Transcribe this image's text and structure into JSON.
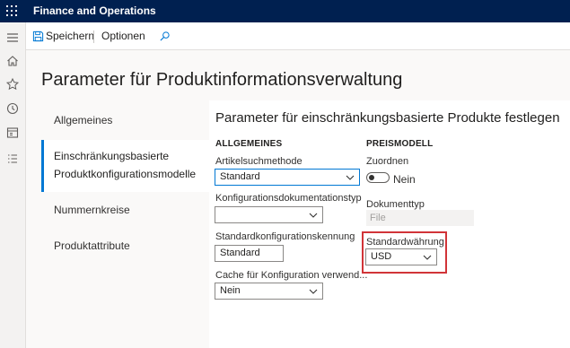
{
  "app": {
    "title": "Finance and Operations"
  },
  "actionbar": {
    "save_label": "Speichern",
    "options_label": "Optionen"
  },
  "page": {
    "title": "Parameter für Produktinformationsverwaltung"
  },
  "sidenav": {
    "items": [
      {
        "label": "Allgemeines"
      },
      {
        "label_line1": "Einschränkungsbasierte",
        "label_line2": "Produktkonfigurationsmodelle"
      },
      {
        "label": "Nummernkreise"
      },
      {
        "label": "Produktattribute"
      }
    ],
    "active_index": 1
  },
  "section": {
    "title": "Parameter für einschränkungsbasierte Produkte festlegen",
    "general": {
      "title": "ALLGEMEINES",
      "fields": {
        "item_search": {
          "label": "Artikelsuchmethode",
          "value": "Standard"
        },
        "config_doc_type": {
          "label": "Konfigurationsdokumentationstyp",
          "value": ""
        },
        "std_config_id": {
          "label": "Standardkonfigurationskennung",
          "value": "Standard"
        },
        "cache": {
          "label": "Cache für Konfiguration verwend...",
          "value": "Nein"
        }
      }
    },
    "price_model": {
      "title": "PREISMODELL",
      "fields": {
        "assign": {
          "label": "Zuordnen",
          "value": "Nein",
          "toggle_on": false
        },
        "doc_type": {
          "label": "Dokumenttyp",
          "value": "File"
        },
        "std_currency": {
          "label": "Standardwährung",
          "value": "USD"
        }
      }
    }
  },
  "colors": {
    "topbar": "#002050",
    "accent": "#0078d4",
    "highlight": "#d13438"
  }
}
